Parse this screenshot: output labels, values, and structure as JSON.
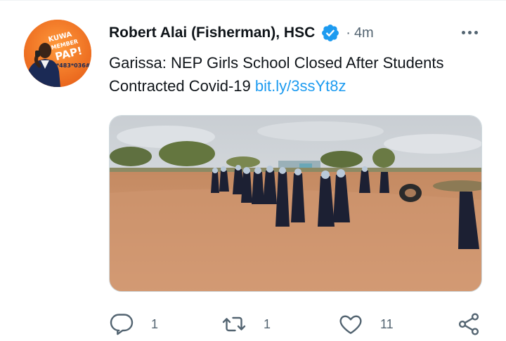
{
  "tweet": {
    "author_name": "Robert Alai (Fisherman), HSC",
    "separator": "·",
    "time_ago": "4m",
    "text_main": "Garissa: NEP Girls School Closed After Students Contracted Covid-19",
    "link_text": "bit.ly/3ssYt8z",
    "avatar_text": {
      "line1": "KUWA",
      "line2": "MEMBER",
      "line3": "PAP!",
      "code": "*483*036#"
    },
    "actions": {
      "reply_count": "1",
      "retweet_count": "1",
      "like_count": "11"
    }
  },
  "colors": {
    "link": "#1d9bf0",
    "verified": "#1d9bf0",
    "secondary_text": "#536471",
    "avatar_bg": "#f47b20"
  },
  "icons": {
    "verified": "verified-badge-icon",
    "more": "more-dots-icon",
    "reply": "speech-bubble-icon",
    "retweet": "retweet-arrows-icon",
    "like": "heart-icon",
    "share": "share-nodes-icon"
  }
}
